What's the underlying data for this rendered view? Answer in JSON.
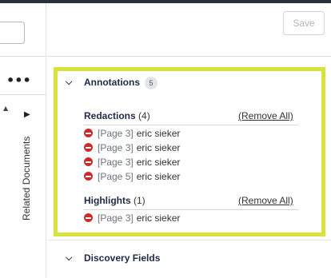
{
  "left": {
    "more_label": "•••",
    "scroll_up_glyph": "▲",
    "related_label": "Related Documents",
    "related_arrow": "▶"
  },
  "toolbar": {
    "save_label": "Save"
  },
  "annotations": {
    "title": "Annotations",
    "count": "5",
    "redactions": {
      "label": "Redactions",
      "count": "(4)",
      "remove_all": "(Remove All)",
      "items": [
        {
          "page": "[Page 3]",
          "author": "eric sieker"
        },
        {
          "page": "[Page 3]",
          "author": "eric sieker"
        },
        {
          "page": "[Page 3]",
          "author": "eric sieker"
        },
        {
          "page": "[Page 5]",
          "author": "eric sieker"
        }
      ]
    },
    "highlights": {
      "label": "Highlights",
      "count": "(1)",
      "remove_all": "(Remove All)",
      "items": [
        {
          "page": "[Page 3]",
          "author": "eric sieker"
        }
      ]
    }
  },
  "discovery": {
    "title": "Discovery Fields"
  },
  "colors": {
    "highlight_border": "#d7e33a",
    "remove_icon": "#cc2a2a",
    "heading": "#1f2a44"
  }
}
